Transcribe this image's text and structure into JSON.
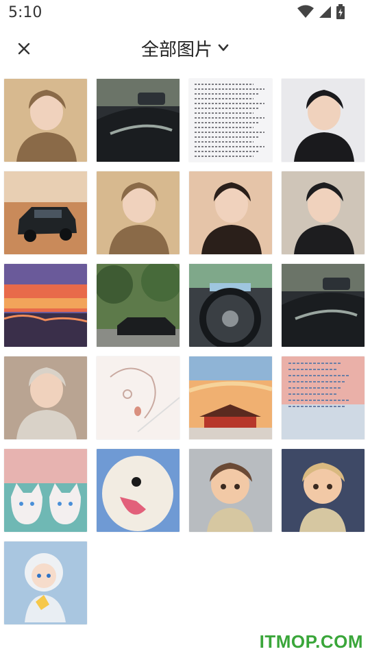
{
  "status_bar": {
    "time": "5:10",
    "icons": [
      "wifi-icon",
      "cellular-signal-icon",
      "battery-charging-icon"
    ]
  },
  "app_bar": {
    "close_icon": "close-icon",
    "title": "全部图片",
    "dropdown_icon": "chevron-down-icon"
  },
  "photos": [
    {
      "name": "photo-girl-bear-hat",
      "kind": "portrait",
      "bg": "#d7b98f",
      "accent": "#8a6a48"
    },
    {
      "name": "photo-car-door-interior",
      "kind": "car-interior",
      "bg": "#2b2f33",
      "accent": "#9aa6a0"
    },
    {
      "name": "photo-handwritten-text",
      "kind": "text-doc",
      "bg": "#f4f4f6",
      "accent": "#7a7a80"
    },
    {
      "name": "photo-man-black-hoodie",
      "kind": "portrait",
      "bg": "#e9e9ec",
      "accent": "#1a1a1d"
    },
    {
      "name": "photo-black-suv-dirt",
      "kind": "suv",
      "bg": "#c98a5a",
      "accent": "#1f2326"
    },
    {
      "name": "photo-girl-bear-hat-2",
      "kind": "portrait",
      "bg": "#d7b98f",
      "accent": "#8a6a48"
    },
    {
      "name": "photo-girl-lying-pillow",
      "kind": "portrait",
      "bg": "#e5c4a8",
      "accent": "#2a1f1a"
    },
    {
      "name": "photo-man-beanie-selfie",
      "kind": "portrait",
      "bg": "#cfc5b8",
      "accent": "#1d1d1f"
    },
    {
      "name": "photo-sunset-sea",
      "kind": "sunset",
      "bg": "#6a5a9a",
      "accent": "#e86a4a"
    },
    {
      "name": "photo-car-under-trees",
      "kind": "trees-car",
      "bg": "#5d7a4a",
      "accent": "#1b1d1f"
    },
    {
      "name": "photo-steering-wheel",
      "kind": "wheel",
      "bg": "#3a3f44",
      "accent": "#9fc6df"
    },
    {
      "name": "photo-car-door-interior-2",
      "kind": "car-interior",
      "bg": "#2b2f33",
      "accent": "#9aa6a0"
    },
    {
      "name": "photo-girl-with-cat",
      "kind": "portrait",
      "bg": "#b9a492",
      "accent": "#d9d2c8"
    },
    {
      "name": "photo-anime-sketch",
      "kind": "sketch",
      "bg": "#f7f1ee",
      "accent": "#c9a9a0"
    },
    {
      "name": "photo-forbidden-city-sunset",
      "kind": "palace",
      "bg": "#f0b071",
      "accent": "#b7372a"
    },
    {
      "name": "photo-text-on-sky",
      "kind": "text-sky",
      "bg": "#eab0a8",
      "accent": "#6a7fa6"
    },
    {
      "name": "photo-two-white-cats",
      "kind": "cats",
      "bg": "#6fb8b4",
      "accent": "#f3efef"
    },
    {
      "name": "photo-white-dog",
      "kind": "dog",
      "bg": "#6f9ad4",
      "accent": "#f2ece2"
    },
    {
      "name": "photo-cartoon-boy",
      "kind": "cartoon",
      "bg": "#b8bcc0",
      "accent": "#6a4a36"
    },
    {
      "name": "photo-cartoon-girl",
      "kind": "cartoon",
      "bg": "#3e4966",
      "accent": "#d9b980"
    },
    {
      "name": "photo-chibi-anime-boy",
      "kind": "chibi",
      "bg": "#a9c6e0",
      "accent": "#e9eef3"
    }
  ],
  "watermark": "ITMOP.COM"
}
